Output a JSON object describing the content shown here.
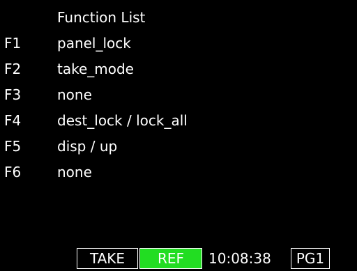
{
  "title": "Function List",
  "functions": [
    {
      "key": "F1",
      "name": "panel_lock"
    },
    {
      "key": "F2",
      "name": "take_mode"
    },
    {
      "key": "F3",
      "name": "none"
    },
    {
      "key": "F4",
      "name": "dest_lock / lock_all"
    },
    {
      "key": "F5",
      "name": "disp / up"
    },
    {
      "key": "F6",
      "name": "none"
    }
  ],
  "status_bar": {
    "take_label": "TAKE",
    "ref_label": "REF",
    "time": "10:08:38",
    "page_label": "PG1"
  },
  "colors": {
    "background": "#000000",
    "text": "#ffffff",
    "ref_active": "#22dd22"
  }
}
